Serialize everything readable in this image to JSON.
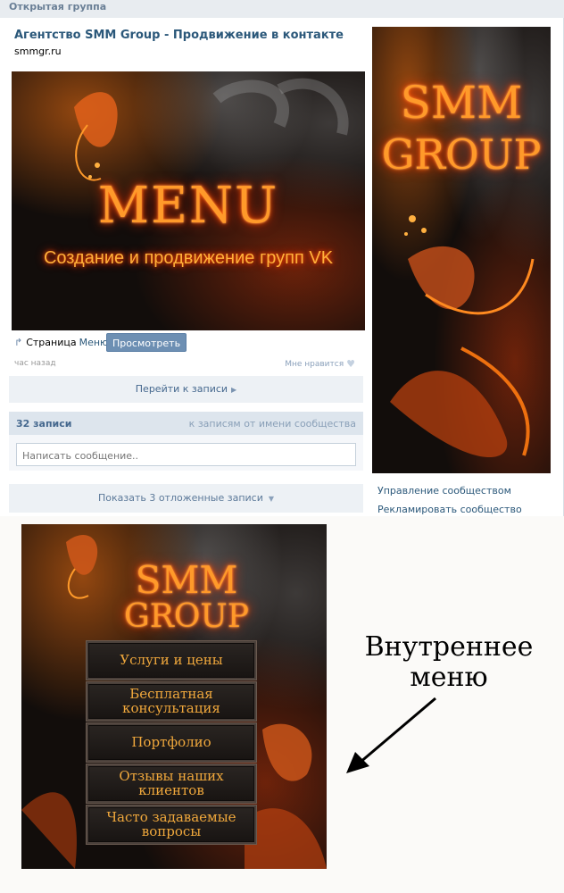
{
  "header": {
    "title": "Открытая группа"
  },
  "group": {
    "name": "Агентство SMM Group - Продвижение в контакте",
    "site": "smmgr.ru"
  },
  "wiki_banner": {
    "title": "MENU",
    "subtitle": "Создание и продвижение групп VK"
  },
  "wiki_caption": {
    "prefix": "Страница",
    "link": "Меню",
    "view_button": "Просмотреть"
  },
  "post": {
    "time": "час назад",
    "like": "Мне нравится"
  },
  "goto_post": "Перейти к записи",
  "wall": {
    "count": "32 записи",
    "from_community": "к записям от имени сообщества",
    "compose_placeholder": "Написать сообщение..",
    "delayed": "Показать 3 отложенные записи"
  },
  "side": {
    "logo_line1": "SMM",
    "logo_line2": "GROUP",
    "links": [
      "Управление сообществом",
      "Рекламировать сообщество"
    ]
  },
  "internal_menu": {
    "logo_line1": "SMM",
    "logo_line2": "GROUP",
    "items": [
      [
        "Услуги и цены"
      ],
      [
        "Бесплатная",
        "консультация"
      ],
      [
        "Портфолио"
      ],
      [
        "Отзывы наших",
        "клиентов"
      ],
      [
        "Часто задаваемые",
        "вопросы"
      ]
    ]
  },
  "annotation": {
    "line1": "Внутреннее",
    "line2": "меню"
  },
  "colors": {
    "vk_blue": "#2b587a",
    "button_blue": "#6d8fb3",
    "fire": "#ff9a2a"
  },
  "icons": {
    "wiki": "page-arrow-icon",
    "like": "heart-icon",
    "goto": "triangle-right-icon",
    "delayed": "triangle-down-icon"
  }
}
